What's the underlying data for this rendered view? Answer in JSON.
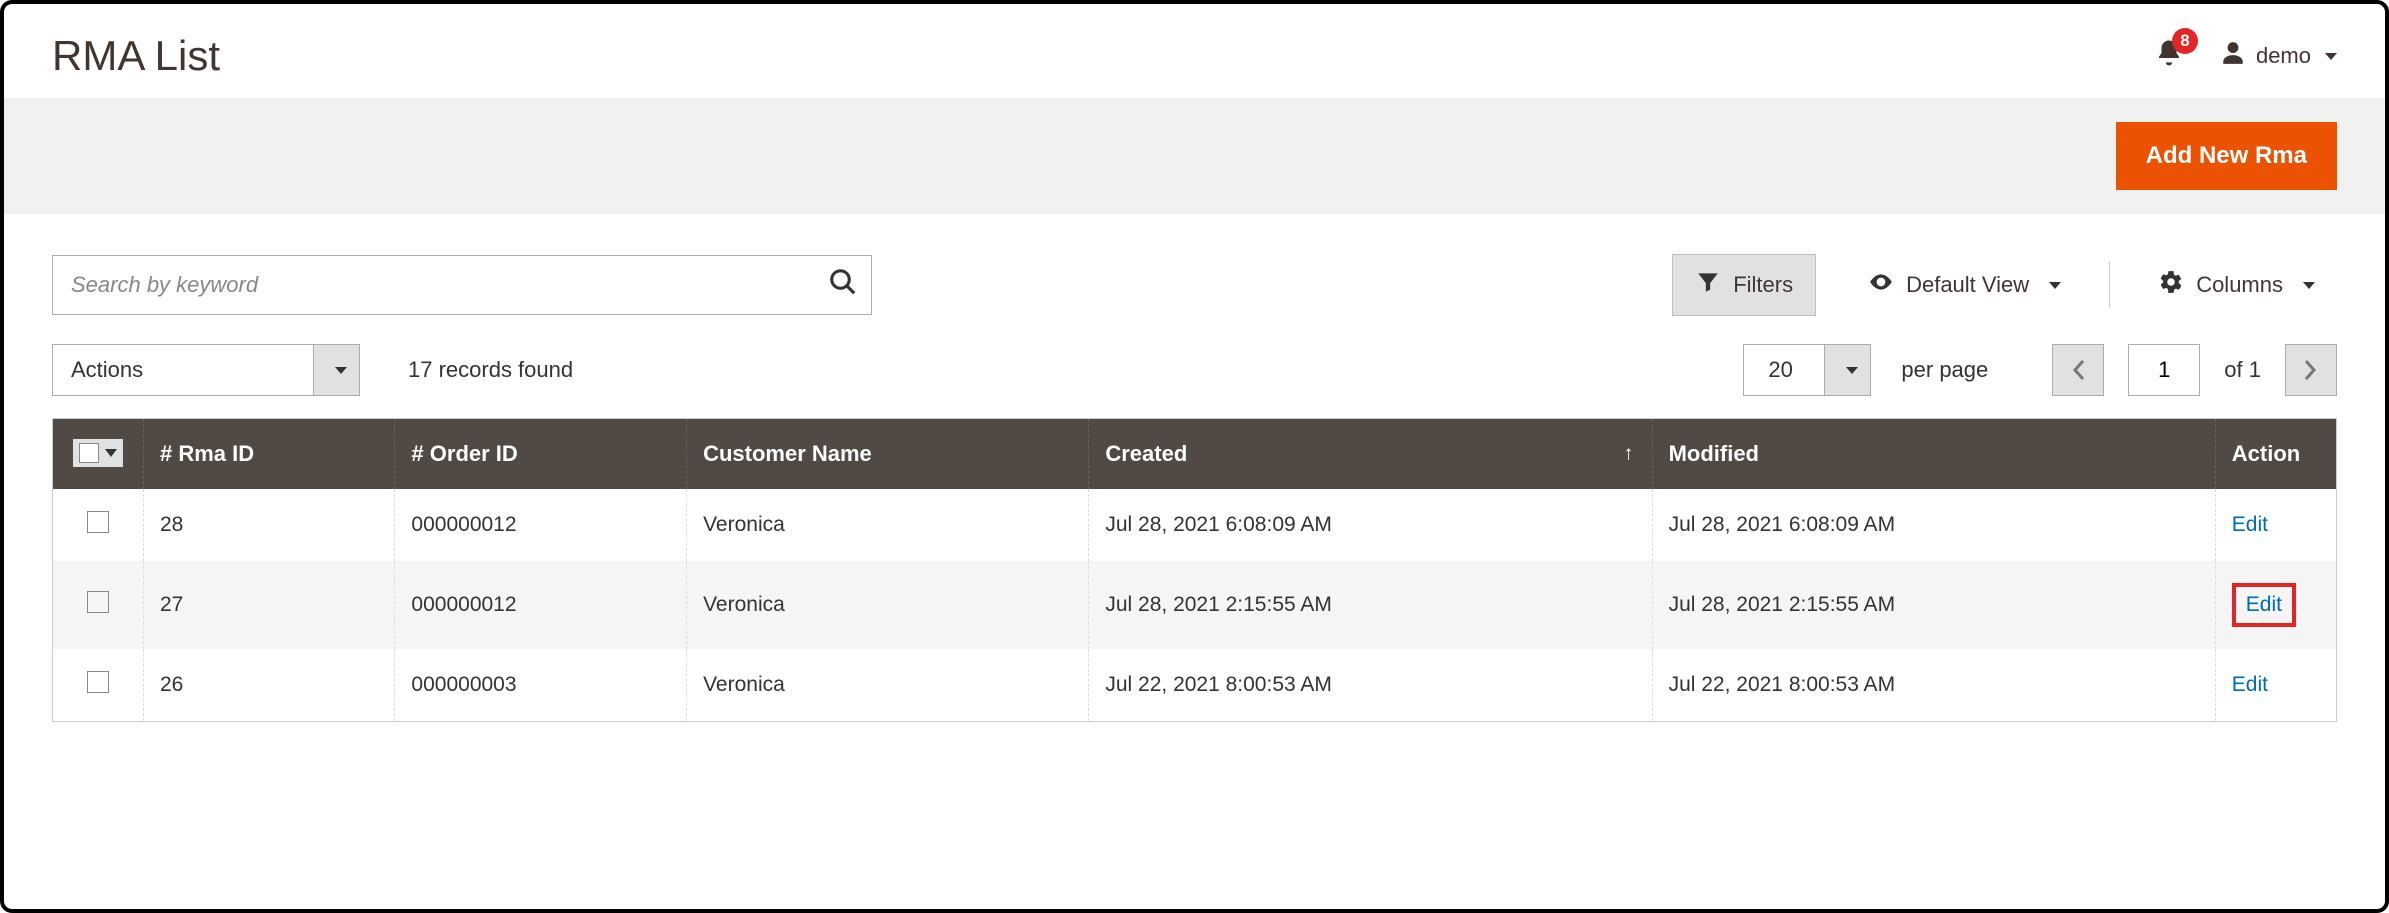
{
  "header": {
    "title": "RMA List",
    "notifications": "8",
    "username": "demo"
  },
  "banner": {
    "add_button": "Add New Rma"
  },
  "controls": {
    "search_placeholder": "Search by keyword",
    "filters_label": "Filters",
    "default_view_label": "Default View",
    "columns_label": "Columns",
    "actions_label": "Actions",
    "records_found": "17 records found",
    "page_size": "20",
    "per_page_label": "per page",
    "current_page": "1",
    "of_label": "of",
    "total_pages": "1"
  },
  "table": {
    "columns": {
      "rma_id": "# Rma ID",
      "order_id": "# Order ID",
      "customer": "Customer Name",
      "created": "Created",
      "modified": "Modified",
      "action": "Action"
    },
    "rows": [
      {
        "rma_id": "28",
        "order_id": "000000012",
        "customer": "Veronica",
        "created": "Jul 28, 2021 6:08:09 AM",
        "modified": "Jul 28, 2021 6:08:09 AM",
        "action": "Edit",
        "highlight": false
      },
      {
        "rma_id": "27",
        "order_id": "000000012",
        "customer": "Veronica",
        "created": "Jul 28, 2021 2:15:55 AM",
        "modified": "Jul 28, 2021 2:15:55 AM",
        "action": "Edit",
        "highlight": true
      },
      {
        "rma_id": "26",
        "order_id": "000000003",
        "customer": "Veronica",
        "created": "Jul 22, 2021 8:00:53 AM",
        "modified": "Jul 22, 2021 8:00:53 AM",
        "action": "Edit",
        "highlight": false
      }
    ]
  }
}
